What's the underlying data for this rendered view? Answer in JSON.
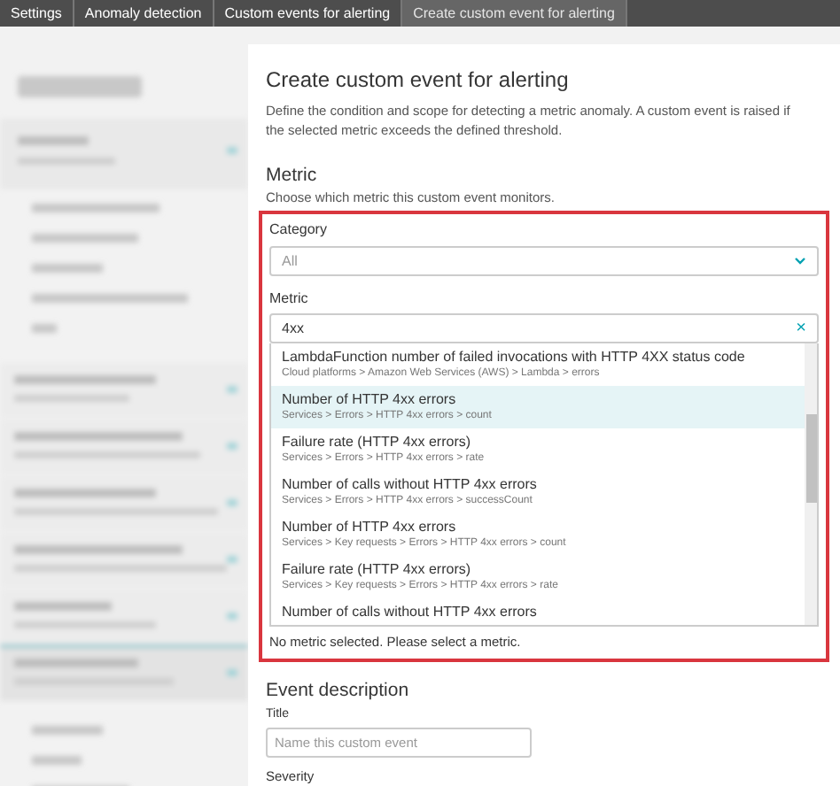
{
  "breadcrumbs": [
    "Settings",
    "Anomaly detection",
    "Custom events for alerting",
    "Create custom event for alerting"
  ],
  "page": {
    "title": "Create custom event for alerting",
    "description": "Define the condition and scope for detecting a metric anomaly. A custom event is raised if the selected metric exceeds the defined threshold."
  },
  "metric_section": {
    "title": "Metric",
    "subtitle": "Choose which metric this custom event monitors.",
    "category": {
      "label": "Category",
      "value": "All"
    },
    "metric": {
      "label": "Metric",
      "value": "4xx",
      "clear": "×"
    },
    "options": [
      {
        "name": "LambdaFunction number of failed invocations with HTTP 4XX status code",
        "path": "Cloud platforms > Amazon Web Services (AWS) > Lambda > errors",
        "hovered": false
      },
      {
        "name": "Number of HTTP 4xx errors",
        "path": "Services > Errors > HTTP 4xx errors > count",
        "hovered": true
      },
      {
        "name": "Failure rate (HTTP 4xx errors)",
        "path": "Services > Errors > HTTP 4xx errors > rate",
        "hovered": false
      },
      {
        "name": "Number of calls without HTTP 4xx errors",
        "path": "Services > Errors > HTTP 4xx errors > successCount",
        "hovered": false
      },
      {
        "name": "Number of HTTP 4xx errors",
        "path": "Services > Key requests > Errors > HTTP 4xx errors > count",
        "hovered": false
      },
      {
        "name": "Failure rate (HTTP 4xx errors)",
        "path": "Services > Key requests > Errors > HTTP 4xx errors > rate",
        "hovered": false
      },
      {
        "name": "Number of calls without HTTP 4xx errors",
        "hovered": false
      }
    ],
    "error": "No metric selected. Please select a metric."
  },
  "event_description": {
    "title": "Event description",
    "title_label": "Title",
    "title_placeholder": "Name this custom event",
    "severity_label": "Severity"
  }
}
